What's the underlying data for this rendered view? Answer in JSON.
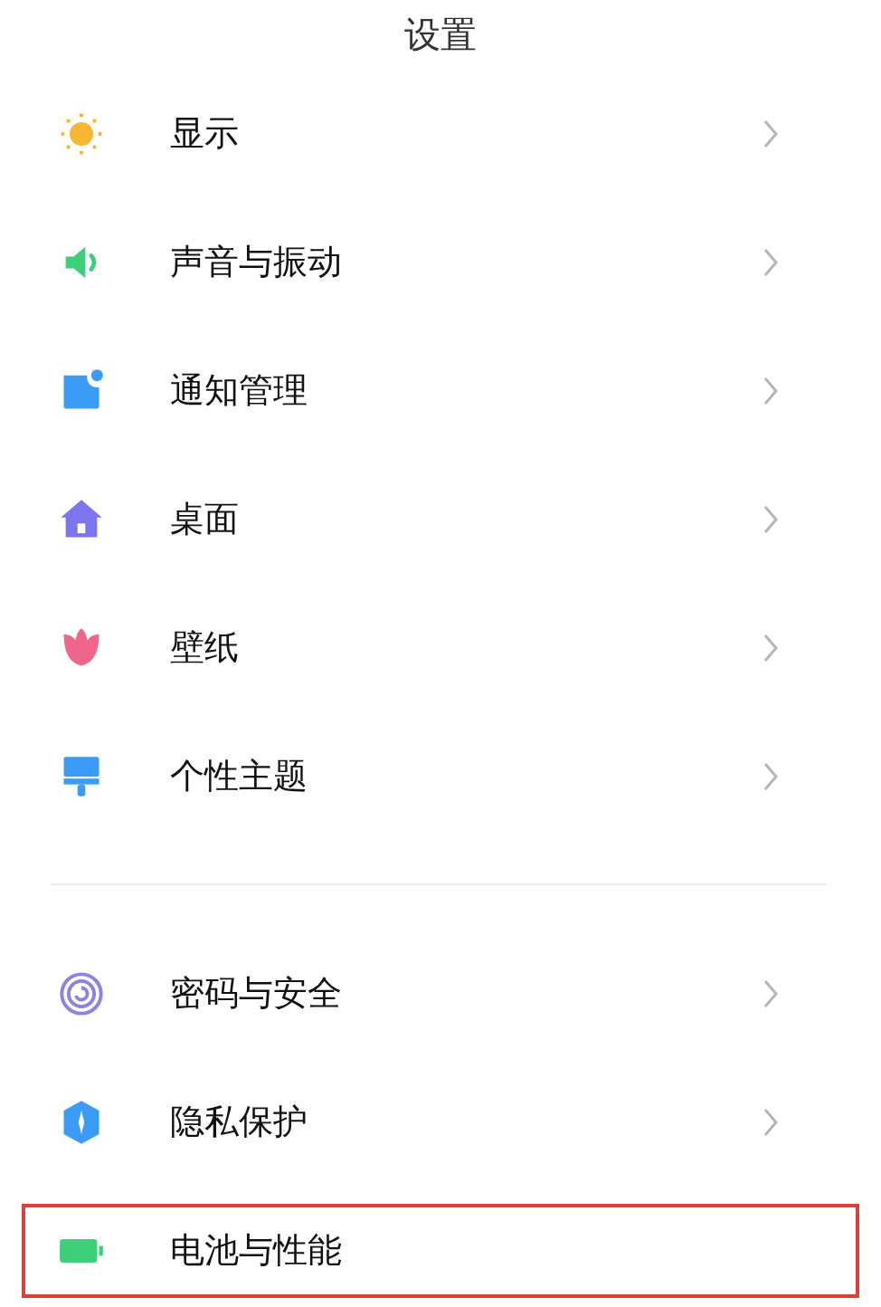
{
  "title": "设置",
  "groups": [
    {
      "items": [
        {
          "label": "显示",
          "kind": "sun",
          "chevron": true,
          "highlighted": false
        },
        {
          "label": "声音与振动",
          "kind": "speaker",
          "chevron": true,
          "highlighted": false
        },
        {
          "label": "通知管理",
          "kind": "notification",
          "chevron": true,
          "highlighted": false
        },
        {
          "label": "桌面",
          "kind": "house",
          "chevron": true,
          "highlighted": false
        },
        {
          "label": "壁纸",
          "kind": "tulip",
          "chevron": true,
          "highlighted": false
        },
        {
          "label": "个性主题",
          "kind": "brush",
          "chevron": true,
          "highlighted": false
        }
      ]
    },
    {
      "items": [
        {
          "label": "密码与安全",
          "kind": "fingerprint",
          "chevron": true,
          "highlighted": false
        },
        {
          "label": "隐私保护",
          "kind": "shield",
          "chevron": true,
          "highlighted": false
        },
        {
          "label": "电池与性能",
          "kind": "battery",
          "chevron": false,
          "highlighted": true
        }
      ]
    }
  ]
}
